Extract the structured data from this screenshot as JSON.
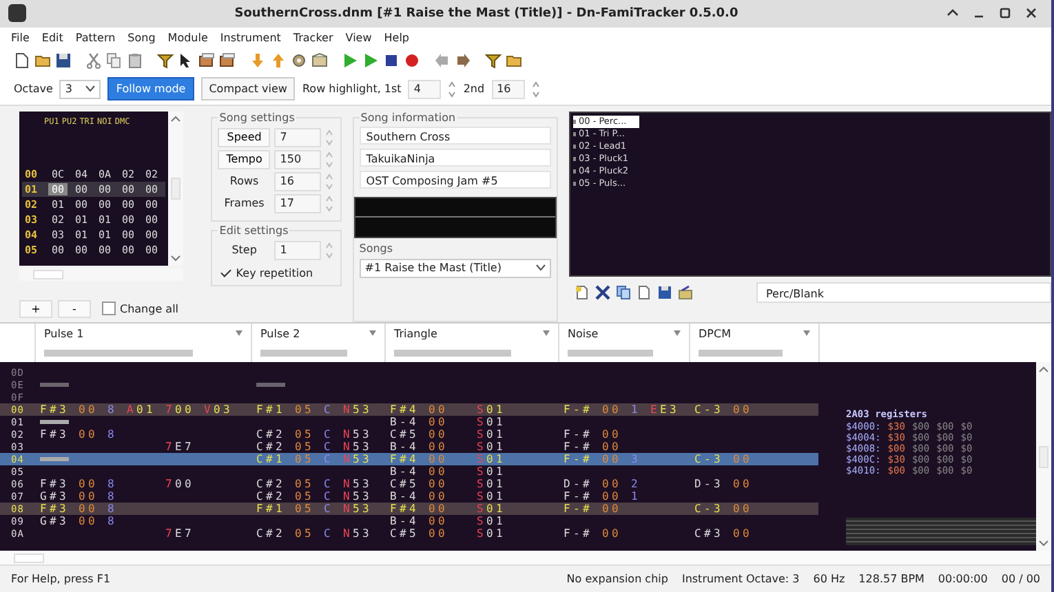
{
  "window": {
    "title": "SouthernCross.dnm [#1 Raise the Mast (Title)] - Dn-FamiTracker 0.5.0.0"
  },
  "menu": [
    "File",
    "Edit",
    "Pattern",
    "Song",
    "Module",
    "Instrument",
    "Tracker",
    "View",
    "Help"
  ],
  "toolbar": {
    "octave_label": "Octave",
    "octave": "3",
    "follow_mode": {
      "label": "Follow mode",
      "selected": true
    },
    "compact_view": {
      "label": "Compact view",
      "selected": false
    },
    "row_highlight_label": "Row highlight, 1st",
    "row_highlight_1st": "4",
    "second_label": "2nd",
    "row_highlight_2nd": "16"
  },
  "frames": {
    "channels": [
      "PU1",
      "PU2",
      "TRI",
      "NOI",
      "DMC"
    ],
    "rows": [
      {
        "label": "00",
        "values": [
          "0C",
          "04",
          "0A",
          "02",
          "02"
        ],
        "selected": false
      },
      {
        "label": "01",
        "values": [
          "00",
          "00",
          "00",
          "00",
          "00"
        ],
        "selected": true
      },
      {
        "label": "02",
        "values": [
          "01",
          "00",
          "00",
          "00",
          "00"
        ],
        "selected": false
      },
      {
        "label": "03",
        "values": [
          "02",
          "01",
          "01",
          "00",
          "00"
        ],
        "selected": false
      },
      {
        "label": "04",
        "values": [
          "03",
          "01",
          "01",
          "00",
          "00"
        ],
        "selected": false
      },
      {
        "label": "05",
        "values": [
          "00",
          "00",
          "00",
          "00",
          "00"
        ],
        "selected": false
      }
    ]
  },
  "frame_buttons": [
    "+",
    "-"
  ],
  "change_all": {
    "label": "Change all",
    "checked": false
  },
  "song_settings": {
    "title": "Song settings",
    "fields": [
      {
        "label": "Speed",
        "value": "7",
        "kind": "button"
      },
      {
        "label": "Tempo",
        "value": "150",
        "kind": "button"
      },
      {
        "label": "Rows",
        "value": "16",
        "kind": "label"
      },
      {
        "label": "Frames",
        "value": "17",
        "kind": "label"
      }
    ]
  },
  "edit_settings": {
    "title": "Edit settings",
    "step_label": "Step",
    "step": "1",
    "key_repetition": {
      "label": "Key repetition",
      "checked": true
    }
  },
  "song_information": {
    "title": "Song information",
    "fields": [
      "Southern Cross",
      "TakuikaNinja",
      "OST Composing Jam #5"
    ],
    "songs_label": "Songs",
    "song": "#1 Raise the Mast (Title)"
  },
  "instruments": {
    "items": [
      {
        "label": "00 - Perc...",
        "selected": true
      },
      {
        "label": "01 - Tri P...",
        "selected": false
      },
      {
        "label": "02 - Lead1",
        "selected": false
      },
      {
        "label": "03 - Pluck1",
        "selected": false
      },
      {
        "label": "04 - Pluck2",
        "selected": false
      },
      {
        "label": "05 - Puls...",
        "selected": false
      }
    ],
    "name": "Perc/Blank"
  },
  "pattern": {
    "channels": [
      "Pulse 1",
      "Pulse 2",
      "Triangle",
      "Noise",
      "DPCM"
    ],
    "rows": [
      {
        "label": "0D",
        "previous_frame": true,
        "highlighted": false,
        "selected": false
      },
      {
        "label": "0E",
        "previous_frame": true,
        "highlighted": false,
        "selected": false,
        "pulse_1": {
          "note_off": true
        },
        "pulse_2": {
          "note_off": true
        }
      },
      {
        "label": "0F",
        "previous_frame": true,
        "highlighted": false,
        "selected": false
      },
      {
        "label": "00",
        "previous_frame": false,
        "highlighted": true,
        "selected": false,
        "pulse_1": {
          "note": "F#3",
          "instrument": "00",
          "volume": "8",
          "effect_1": "A01",
          "effect_2": "700",
          "effect_3": "V03"
        },
        "pulse_2": {
          "note": "F#1",
          "instrument": "05",
          "volume": "C",
          "effect_1": "N53"
        },
        "triangle": {
          "note": "F#4",
          "instrument": "00",
          "effect_1": "S01"
        },
        "noise": {
          "note": "F-#",
          "instrument": "00",
          "volume": "1",
          "effect_1": "EE3"
        },
        "dpcm": {
          "note": "C-3",
          "instrument": "00"
        }
      },
      {
        "label": "01",
        "previous_frame": false,
        "highlighted": false,
        "selected": false,
        "pulse_1": {
          "note_off": true
        },
        "triangle": {
          "note": "B-4",
          "instrument": "00",
          "effect_1": "S01"
        }
      },
      {
        "label": "02",
        "previous_frame": false,
        "highlighted": false,
        "selected": false,
        "pulse_1": {
          "note": "F#3",
          "instrument": "00",
          "volume": "8"
        },
        "pulse_2": {
          "note": "C#2",
          "instrument": "05",
          "volume": "C",
          "effect_1": "N53"
        },
        "triangle": {
          "note": "C#5",
          "instrument": "00",
          "effect_1": "S01"
        },
        "noise": {
          "note": "F-#",
          "instrument": "00"
        }
      },
      {
        "label": "03",
        "previous_frame": false,
        "highlighted": false,
        "selected": false,
        "pulse_1": {
          "effect_2": "7E7"
        },
        "pulse_2": {
          "note": "C#2",
          "instrument": "05",
          "volume": "C",
          "effect_1": "N53"
        },
        "triangle": {
          "note": "B-4",
          "instrument": "00",
          "effect_1": "S01"
        },
        "noise": {
          "note": "F-#",
          "instrument": "00"
        }
      },
      {
        "label": "04",
        "previous_frame": false,
        "highlighted": true,
        "selected": true,
        "pulse_1": {
          "note_off": true
        },
        "pulse_2": {
          "note": "C#1",
          "instrument": "05",
          "volume": "C",
          "effect_1": "N53"
        },
        "triangle": {
          "note": "F#4",
          "instrument": "00",
          "effect_1": "S01"
        },
        "noise": {
          "note": "F-#",
          "instrument": "00",
          "volume": "3"
        },
        "dpcm": {
          "note": "C-3",
          "instrument": "00"
        }
      },
      {
        "label": "05",
        "previous_frame": false,
        "highlighted": false,
        "selected": false,
        "triangle": {
          "note": "B-4",
          "instrument": "00",
          "effect_1": "S01"
        }
      },
      {
        "label": "06",
        "previous_frame": false,
        "highlighted": false,
        "selected": false,
        "pulse_1": {
          "note": "F#3",
          "instrument": "00",
          "volume": "8",
          "effect_2": "700"
        },
        "pulse_2": {
          "note": "C#2",
          "instrument": "05",
          "volume": "C",
          "effect_1": "N53"
        },
        "triangle": {
          "note": "C#5",
          "instrument": "00",
          "effect_1": "S01"
        },
        "noise": {
          "note": "D-#",
          "instrument": "00",
          "volume": "2"
        },
        "dpcm": {
          "note": "D-3",
          "instrument": "00"
        }
      },
      {
        "label": "07",
        "previous_frame": false,
        "highlighted": false,
        "selected": false,
        "pulse_1": {
          "note": "G#3",
          "instrument": "00",
          "volume": "8"
        },
        "pulse_2": {
          "note": "C#2",
          "instrument": "05",
          "volume": "C",
          "effect_1": "N53"
        },
        "triangle": {
          "note": "B-4",
          "instrument": "00",
          "effect_1": "S01"
        },
        "noise": {
          "note": "F-#",
          "instrument": "00",
          "volume": "1"
        }
      },
      {
        "label": "08",
        "previous_frame": false,
        "highlighted": true,
        "selected": false,
        "pulse_1": {
          "note": "F#3",
          "instrument": "00",
          "volume": "8"
        },
        "pulse_2": {
          "note": "F#1",
          "instrument": "05",
          "volume": "C",
          "effect_1": "N53"
        },
        "triangle": {
          "note": "F#4",
          "instrument": "00",
          "effect_1": "S01"
        },
        "noise": {
          "note": "F-#",
          "instrument": "00"
        },
        "dpcm": {
          "note": "C-3",
          "instrument": "00"
        }
      },
      {
        "label": "09",
        "previous_frame": false,
        "highlighted": false,
        "selected": false,
        "pulse_1": {
          "note": "G#3",
          "instrument": "00",
          "volume": "8"
        },
        "triangle": {
          "note": "B-4",
          "instrument": "00",
          "effect_1": "S01"
        }
      },
      {
        "label": "0A",
        "previous_frame": false,
        "highlighted": false,
        "selected": false,
        "pulse_1": {
          "effect_2": "7E7"
        },
        "pulse_2": {
          "note": "C#2",
          "instrument": "05",
          "volume": "C",
          "effect_1": "N53"
        },
        "triangle": {
          "note": "C#5",
          "instrument": "00",
          "effect_1": "S01"
        },
        "noise": {
          "note": "F-#",
          "instrument": "00"
        },
        "dpcm": {
          "note": "C#3",
          "instrument": "00"
        }
      }
    ],
    "registers": {
      "title": "2A03 registers",
      "lines": [
        {
          "address": "$4000:",
          "values": [
            "$30",
            "$00",
            "$00",
            "$0"
          ]
        },
        {
          "address": "$4004:",
          "values": [
            "$30",
            "$00",
            "$00",
            "$0"
          ]
        },
        {
          "address": "$4008:",
          "values": [
            "$00",
            "$00",
            "$00",
            "$0"
          ]
        },
        {
          "address": "$400C:",
          "values": [
            "$30",
            "$00",
            "$00",
            "$0"
          ]
        },
        {
          "address": "$4010:",
          "values": [
            "$00",
            "$00",
            "$00",
            "$0"
          ]
        }
      ]
    }
  },
  "status_bar": {
    "help": "For Help, press F1",
    "panes": [
      "No expansion chip",
      "Instrument Octave: 3",
      "60 Hz",
      "128.57 BPM",
      "00:00:00",
      "00 / 00"
    ]
  }
}
